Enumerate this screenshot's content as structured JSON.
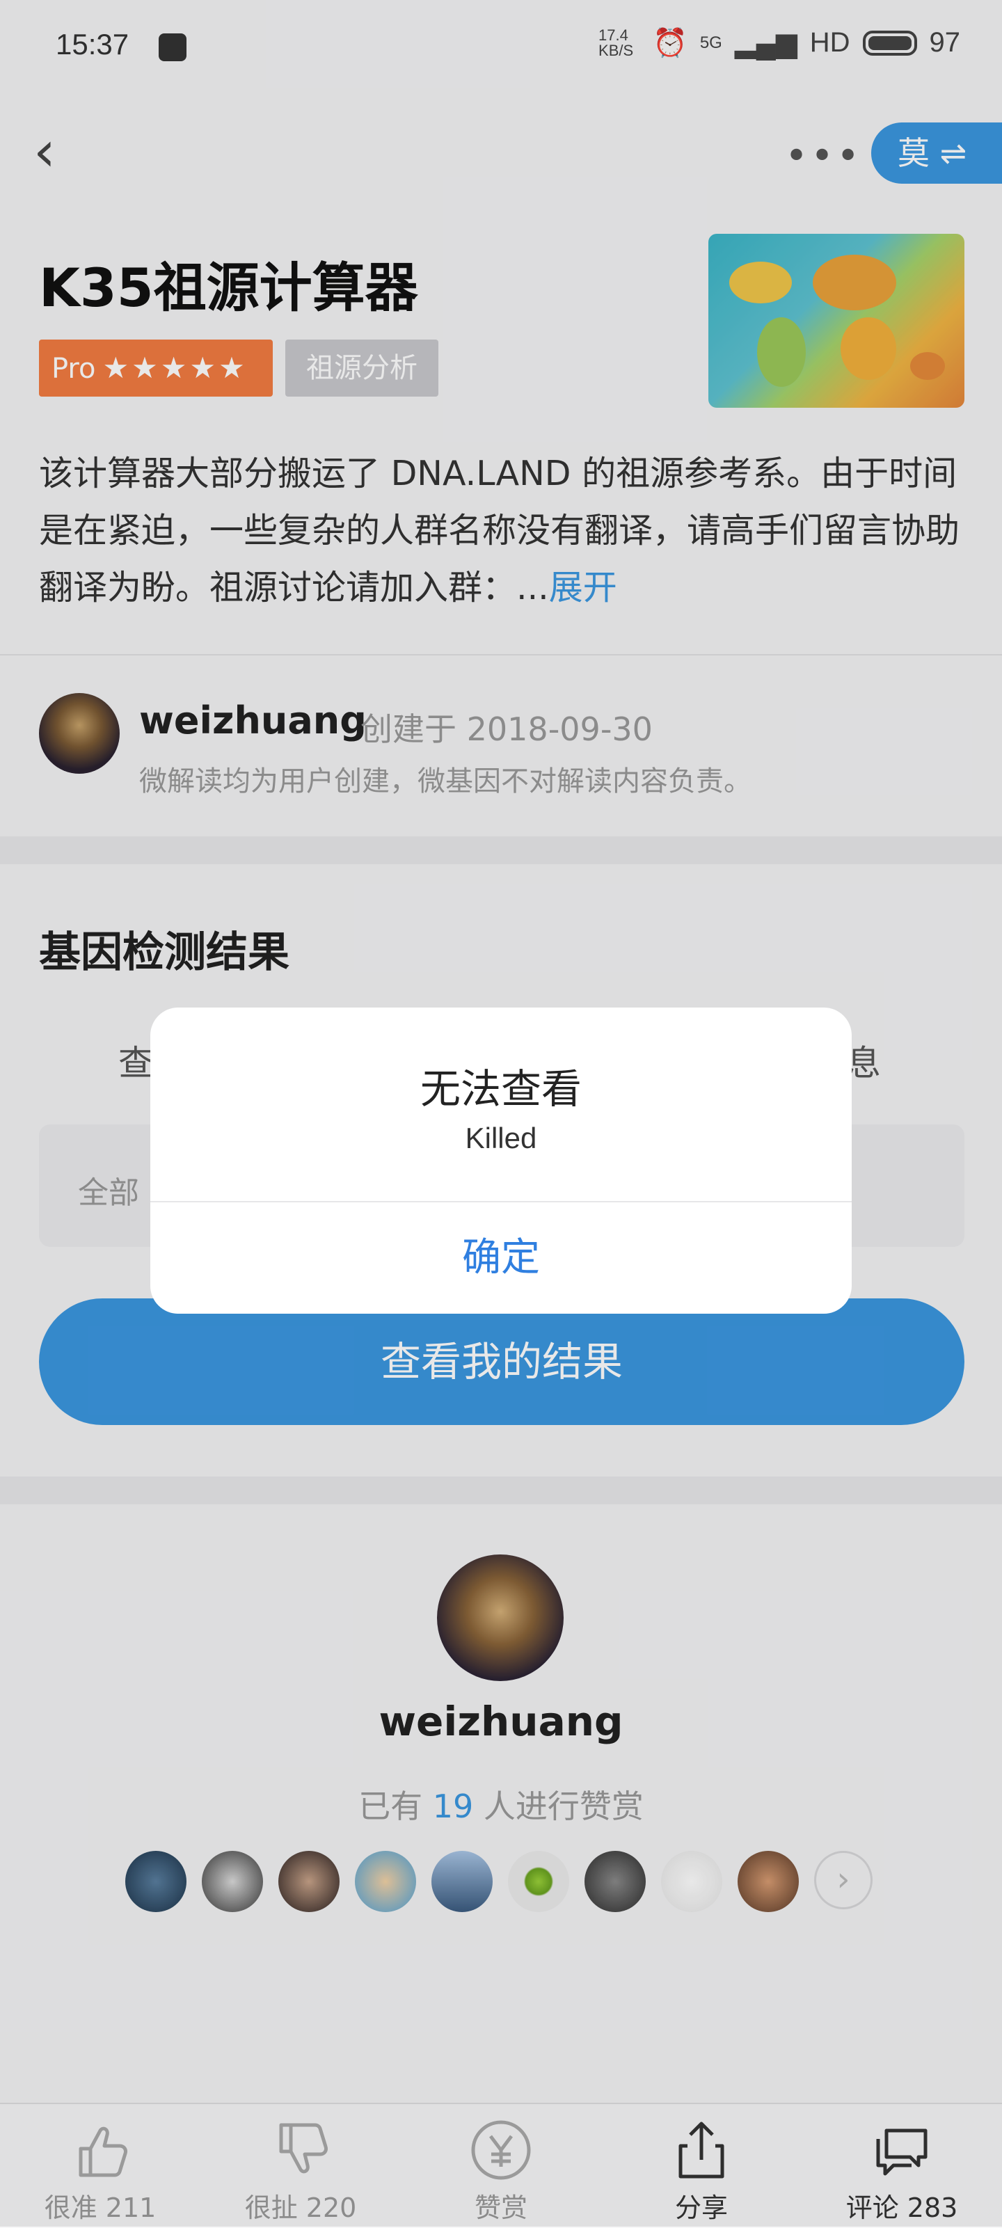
{
  "status_bar": {
    "time": "15:37",
    "net_speed": "17.4 KB/S",
    "network": "5G",
    "hd": "HD",
    "battery": "97"
  },
  "header": {
    "lang_label": "莫 ⇌"
  },
  "calculator": {
    "title": "K35祖源计算器",
    "pro_label": "Pro",
    "rating_stars": "★★★★★",
    "rating": 4.5,
    "category_tag": "祖源分析",
    "description": "该计算器大部分搬运了 DNA.LAND 的祖源参考系。由于时间是在紧迫，一些复杂的人群名称没有翻译，请高手们留言协助翻译为盼。祖源讨论请加入群：...",
    "expand_label": "展开"
  },
  "author": {
    "name": "weizhuang",
    "created": "创建于 2018-09-30",
    "disclaimer": "微解读均为用户创建，微基因不对解读内容负责。"
  },
  "results": {
    "section_title": "基因检测结果",
    "peek_left": "查",
    "peek_right": "息",
    "select_placeholder": "全部",
    "view_button": "查看我的结果"
  },
  "reward": {
    "name": "weizhuang",
    "prefix": "已有",
    "count": "19",
    "suffix": "人进行赞赏",
    "more_label": "›"
  },
  "bottom_tabs": [
    {
      "label": "很准 211"
    },
    {
      "label": "很扯 220"
    },
    {
      "label": "赞赏"
    },
    {
      "label": "分享"
    },
    {
      "label": "评论 283"
    }
  ],
  "dialog": {
    "title": "无法查看",
    "message": "Killed",
    "confirm": "确定"
  },
  "colors": {
    "accent": "#3b97e0",
    "pro": "#f27c41",
    "tag": "#c9c9cd",
    "dialog_button": "#2f7fe0"
  }
}
